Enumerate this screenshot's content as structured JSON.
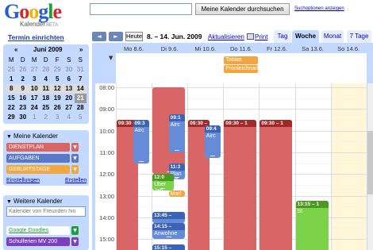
{
  "header": {
    "logo_word": "Google",
    "logo_letters": [
      {
        "ch": "G",
        "color": "#2a5bd7"
      },
      {
        "ch": "o",
        "color": "#d6262b"
      },
      {
        "ch": "o",
        "color": "#f0b400"
      },
      {
        "ch": "g",
        "color": "#2a5bd7"
      },
      {
        "ch": "l",
        "color": "#1c9e3a"
      },
      {
        "ch": "e",
        "color": "#d6262b"
      }
    ],
    "logo_sub": "Kalender",
    "logo_beta": "BETA",
    "search_value": "",
    "search_button": "Meine Kalender durchsuchen",
    "search_options": "Suchoptionen anzeigen"
  },
  "sidebar": {
    "create_link": "Termin einrichten",
    "minical": {
      "prev": "«",
      "month": "Juni 2009",
      "next": "»",
      "dow": [
        "M",
        "D",
        "M",
        "D",
        "F",
        "S",
        "S"
      ],
      "weeks": [
        [
          [
            "25",
            "o"
          ],
          [
            "26",
            "o"
          ],
          [
            "27",
            "o"
          ],
          [
            "28",
            "o"
          ],
          [
            "29",
            "o"
          ],
          [
            "30",
            "o"
          ],
          [
            "31",
            "o"
          ]
        ],
        [
          [
            "1",
            ""
          ],
          [
            "2",
            ""
          ],
          [
            "3",
            ""
          ],
          [
            "4",
            ""
          ],
          [
            "5",
            ""
          ],
          [
            "6",
            ""
          ],
          [
            "7",
            ""
          ]
        ],
        [
          [
            "8",
            "s"
          ],
          [
            "9",
            "s"
          ],
          [
            "10",
            "s"
          ],
          [
            "11",
            "s"
          ],
          [
            "12",
            "s"
          ],
          [
            "13",
            "s"
          ],
          [
            "14",
            "s"
          ]
        ],
        [
          [
            "15",
            ""
          ],
          [
            "16",
            ""
          ],
          [
            "17",
            ""
          ],
          [
            "18",
            ""
          ],
          [
            "19",
            ""
          ],
          [
            "20",
            ""
          ],
          [
            "21",
            "t"
          ]
        ],
        [
          [
            "22",
            ""
          ],
          [
            "23",
            ""
          ],
          [
            "24",
            ""
          ],
          [
            "25",
            ""
          ],
          [
            "26",
            ""
          ],
          [
            "27",
            ""
          ],
          [
            "28",
            ""
          ]
        ],
        [
          [
            "29",
            ""
          ],
          [
            "30",
            ""
          ],
          [
            "1",
            "o"
          ],
          [
            "2",
            "o"
          ],
          [
            "3",
            "o"
          ],
          [
            "4",
            "o"
          ],
          [
            "5",
            "o"
          ]
        ]
      ]
    },
    "my_calendars": {
      "title": "Meine Kalender",
      "items": [
        {
          "label": "DIENSTPLAN",
          "color": "#d96666"
        },
        {
          "label": "AUFGABEN",
          "color": "#5a78c8"
        },
        {
          "label": "GEBURTSTAGE",
          "color": "#f2a640"
        }
      ],
      "settings": "Einstellungen",
      "create": "Erstellen"
    },
    "other_calendars": {
      "title": "Weitere Kalender",
      "friend_placeholder": "Kalender von Freunden hin",
      "items": [
        {
          "label": "Google Doodles",
          "color": "#1c9e3a",
          "style": "text"
        },
        {
          "label": "Schulferien MV 200",
          "color": "#7b3fbf",
          "style": "chip"
        }
      ]
    }
  },
  "toolbar": {
    "prev": "◄",
    "next": "►",
    "today": "Heute",
    "date_range": "8. – 14. Jun. 2009",
    "refresh": "Aktualisieren",
    "print": "Print",
    "tabs": [
      {
        "label": "Tag",
        "active": false
      },
      {
        "label": "Woche",
        "active": true
      },
      {
        "label": "Monat",
        "active": false
      },
      {
        "label": "7 Tage",
        "active": false
      }
    ]
  },
  "calendar": {
    "days": [
      "Mo 8.6.",
      "Di 9.6.",
      "Mi 10.6.",
      "Do 11.6.",
      "Fr 12.6.",
      "Sa 13.6.",
      "So 14.6."
    ],
    "hours": [
      "08:00",
      "09:00",
      "10:00",
      "11:00",
      "12:00",
      "13:00",
      "14:00",
      "15:00"
    ],
    "allday_events": [
      {
        "day": 3,
        "row": 0,
        "title": "Tobias"
      },
      {
        "day": 3,
        "row": 1,
        "title": "Pronleichnam"
      }
    ],
    "events": [
      {
        "day": 0,
        "sub": 0,
        "subs": 2,
        "start": "09:30",
        "end": "16:00",
        "label": "09:30 –",
        "text": "",
        "color": "#d96666",
        "head": "#a32929"
      },
      {
        "day": 0,
        "sub": 1,
        "subs": 2,
        "start": "09:30",
        "end": "11:30",
        "label": "09:3",
        "text": "Airc",
        "color": "#668cd9",
        "head": "#3c63b5"
      },
      {
        "day": 1,
        "sub": 0,
        "subs": 1,
        "start": "08:00",
        "end": "12:00",
        "label": "",
        "text": "",
        "color": "#d96666",
        "head": "#a32929"
      },
      {
        "day": 1,
        "sub": 1,
        "subs": 2,
        "start": "09:15",
        "end": "11:00",
        "label": "09:1",
        "text": "Airc",
        "color": "#668cd9",
        "head": "#3c63b5"
      },
      {
        "day": 1,
        "sub": 1,
        "subs": 2,
        "start": "11:30",
        "end": "12:15",
        "label": "11:3",
        "text": "Plan\nGB",
        "color": "#668cd9",
        "head": "#3c63b5"
      },
      {
        "day": 1,
        "sub": 0,
        "subs": 2,
        "start": "12:00",
        "end": "12:45",
        "label": "12:0",
        "text": "Über\nJan",
        "color": "#7bd148",
        "head": "#4a9a1f"
      },
      {
        "day": 1,
        "sub": 1,
        "subs": 2,
        "start": "12:45",
        "end": "13:00",
        "label": "",
        "text": "Marl",
        "color": "#f2a640",
        "head": "#d47f0f"
      },
      {
        "day": 1,
        "sub": 0,
        "subs": 1,
        "start": "13:45",
        "end": "14:15",
        "label": "13:45 –",
        "text": "",
        "color": "#668cd9",
        "head": "#3c63b5"
      },
      {
        "day": 1,
        "sub": 0,
        "subs": 1,
        "start": "14:15",
        "end": "15:00",
        "label": "14:15 –",
        "text": "Anwohne",
        "color": "#668cd9",
        "head": "#3c63b5"
      },
      {
        "day": 1,
        "sub": 0,
        "subs": 1,
        "start": "15:15",
        "end": "16:00",
        "label": "15:15 –",
        "text": "",
        "color": "#668cd9",
        "head": "#3c63b5"
      },
      {
        "day": 2,
        "sub": 0,
        "subs": 2,
        "start": "09:30",
        "end": "16:00",
        "label": "09:30 –",
        "text": "",
        "color": "#d96666",
        "head": "#a32929"
      },
      {
        "day": 2,
        "sub": 1,
        "subs": 2,
        "start": "09:45",
        "end": "11:15",
        "label": "09:4",
        "text": "Airc",
        "color": "#668cd9",
        "head": "#3c63b5"
      },
      {
        "day": 3,
        "sub": 0,
        "subs": 1,
        "start": "09:30",
        "end": "16:00",
        "label": "09:30 – 1",
        "text": "",
        "color": "#d96666",
        "head": "#a32929"
      },
      {
        "day": 4,
        "sub": 0,
        "subs": 1,
        "start": "09:30",
        "end": "16:00",
        "label": "09:30 – 1",
        "text": "",
        "color": "#d96666",
        "head": "#a32929"
      },
      {
        "day": 5,
        "sub": 0,
        "subs": 1,
        "start": "13:15",
        "end": "16:00",
        "label": "13:15 – 1",
        "text": "St",
        "color": "#7bd148",
        "head": "#4a9a1f"
      }
    ]
  }
}
